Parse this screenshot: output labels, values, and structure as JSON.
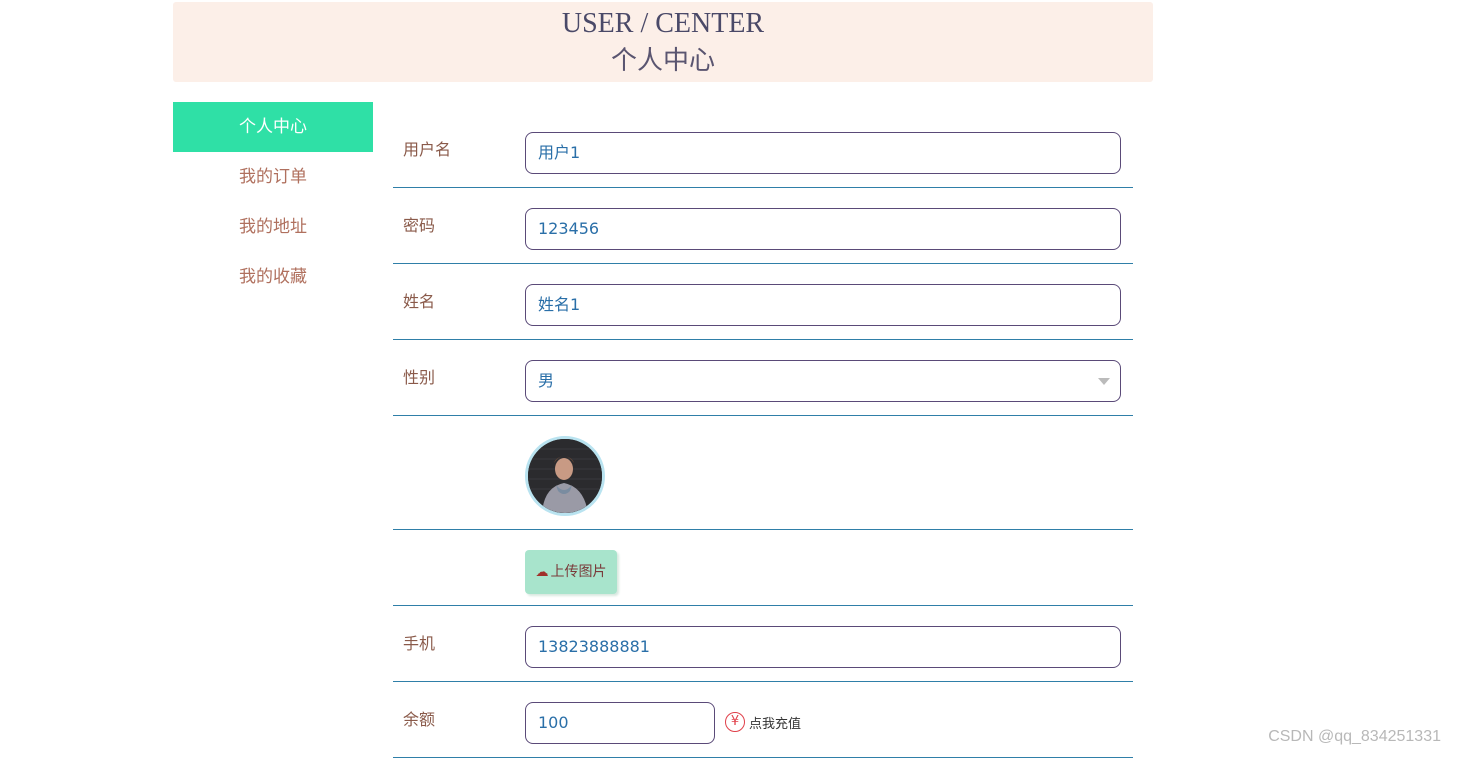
{
  "header": {
    "title_en": "USER / CENTER",
    "title_cn": "个人中心"
  },
  "sidebar": {
    "items": [
      {
        "label": "个人中心",
        "active": true
      },
      {
        "label": "我的订单"
      },
      {
        "label": "我的地址"
      },
      {
        "label": "我的收藏"
      }
    ]
  },
  "form": {
    "username": {
      "label": "用户名",
      "value": "用户1"
    },
    "password": {
      "label": "密码",
      "value": "123456"
    },
    "name": {
      "label": "姓名",
      "value": "姓名1"
    },
    "gender": {
      "label": "性别",
      "value": "男"
    },
    "upload": {
      "label": "上传图片",
      "icon": "cloud-upload-icon"
    },
    "phone": {
      "label": "手机",
      "value": "13823888881"
    },
    "balance": {
      "label": "余额",
      "value": "100",
      "recharge_label": "点我充值",
      "recharge_icon": "¥"
    }
  },
  "watermark": "CSDN @qq_834251331",
  "colors": {
    "accent": "#2fe0a6",
    "header_bg": "#fcefe8",
    "divider": "#2f7fa8",
    "upload_bg": "#a8e4cc"
  }
}
